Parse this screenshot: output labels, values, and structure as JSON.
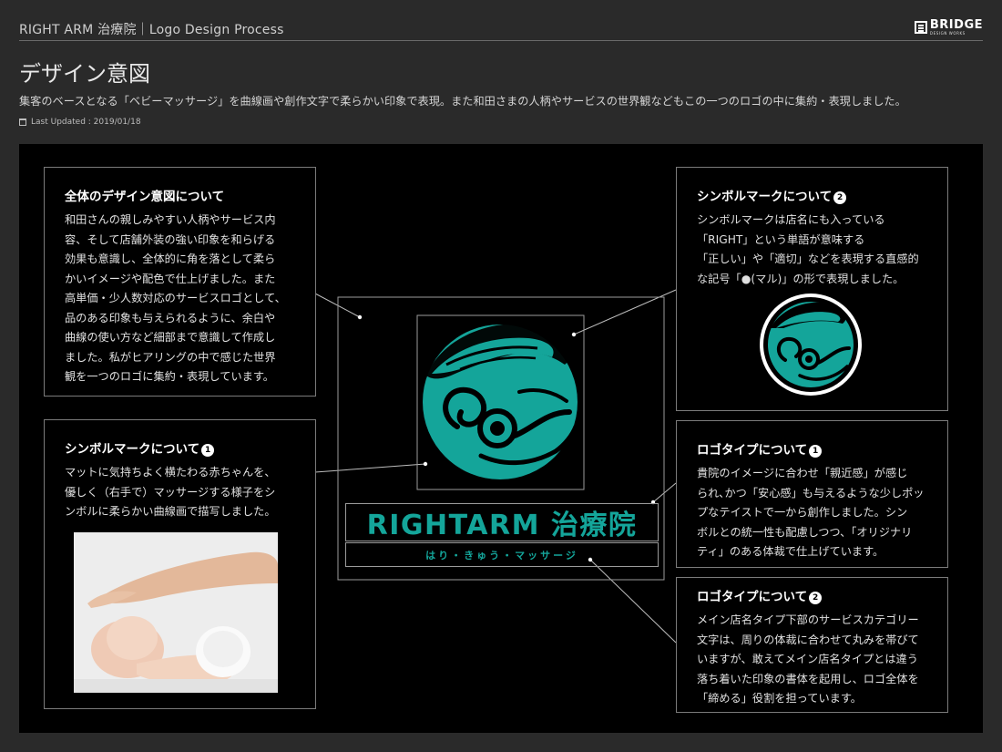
{
  "header": {
    "title": "RIGHT ARM 治療院｜Logo Design Process",
    "brand_name": "BRIDGE",
    "brand_sub": "DESIGN WORKS"
  },
  "page": {
    "title": "デザイン意図",
    "intro": "集客のベースとなる「ベビーマッサージ」を曲線画や創作文字で柔らかい印象で表現。また和田さまの人柄やサービスの世界観などもこの一つのロゴの中に集約・表現しました。",
    "updated": "Last Updated : 2019/01/18"
  },
  "sections": {
    "overall": {
      "title": "全体のデザイン意図について",
      "lines": [
        "和田さんの親しみやすい人柄やサービス内",
        "容、そして店舗外装の強い印象を和らげる",
        "効果も意識し、全体的に角を落として柔ら",
        "かいイメージや配色で仕上げました。また",
        "高単価・少人数対応のサービスロゴとして、",
        "品のある印象も与えられるように、余白や",
        "曲線の使い方など細部まで意識して作成し",
        "ました。私がヒアリングの中で感じた世界",
        "観を一つのロゴに集約・表現しています。"
      ]
    },
    "symbol1": {
      "title": "シンボルマークについて",
      "num": "1",
      "lines": [
        "マットに気持ちよく横たわる赤ちゃんを、",
        "優しく（右手で）マッサージする様子をシ",
        "ンボルに柔らかい曲線画で描写しました。"
      ]
    },
    "symbol2": {
      "title": "シンボルマークについて",
      "num": "2",
      "lines": [
        "シンボルマークは店名にも入っている",
        "「RIGHT」という単語が意味する",
        "「正しい」や「適切」などを表現する直感的",
        "な記号「●(マル)」の形で表現しました。"
      ]
    },
    "logotype1": {
      "title": "ロゴタイプについて",
      "num": "1",
      "lines": [
        "貴院のイメージに合わせ「親近感」が感じ",
        "られ､かつ「安心感」も与えるような少しポッ",
        "プなテイストで一から創作しました。シン",
        "ボルとの統一性も配慮しつつ、「オリジナリ",
        "ティ」のある体裁で仕上げています。"
      ]
    },
    "logotype2": {
      "title": "ロゴタイプについて",
      "num": "2",
      "lines": [
        "メイン店名タイプ下部のサービスカテゴリー",
        "文字は、周りの体裁に合わせて丸みを帯びて",
        "いますが、敢えてメイン店名タイプとは違う",
        "落ち着いた印象の書体を起用し、ロゴ全体を",
        "「締める」役割を担っています。"
      ]
    }
  },
  "logo": {
    "name": "RIGHTARM 治療院",
    "sub": "はり・きゅう・マッサージ",
    "color": "#14a59a"
  }
}
